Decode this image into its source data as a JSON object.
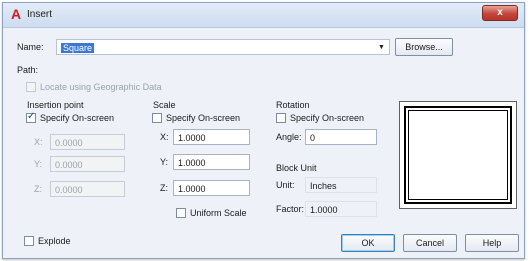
{
  "window": {
    "title": "Insert",
    "close_label": "x",
    "app_icon": "autocad-a-icon"
  },
  "name": {
    "label": "Name:",
    "value": "Square"
  },
  "buttons": {
    "browse": "Browse...",
    "ok": "OK",
    "cancel": "Cancel",
    "help": "Help"
  },
  "path": {
    "label": "Path:",
    "geo_label": "Locate using Geographic Data"
  },
  "insertion_point": {
    "heading": "Insertion point",
    "specify_label": "Specify On-screen",
    "x_label": "X:",
    "y_label": "Y:",
    "z_label": "Z:",
    "x": "0.0000",
    "y": "0.0000",
    "z": "0.0000"
  },
  "scale": {
    "heading": "Scale",
    "specify_label": "Specify On-screen",
    "x_label": "X:",
    "y_label": "Y:",
    "z_label": "Z:",
    "x": "1.0000",
    "y": "1.0000",
    "z": "1.0000",
    "uniform_label": "Uniform Scale"
  },
  "rotation": {
    "heading": "Rotation",
    "specify_label": "Specify On-screen",
    "angle_label": "Angle:",
    "angle": "0"
  },
  "block_unit": {
    "heading": "Block Unit",
    "unit_label": "Unit:",
    "unit": "Inches",
    "factor_label": "Factor:",
    "factor": "1.0000"
  },
  "explode_label": "Explode",
  "colors": {
    "selection": "#3b78d4",
    "close": "#c4463a",
    "app_icon": "#d21e1e"
  }
}
